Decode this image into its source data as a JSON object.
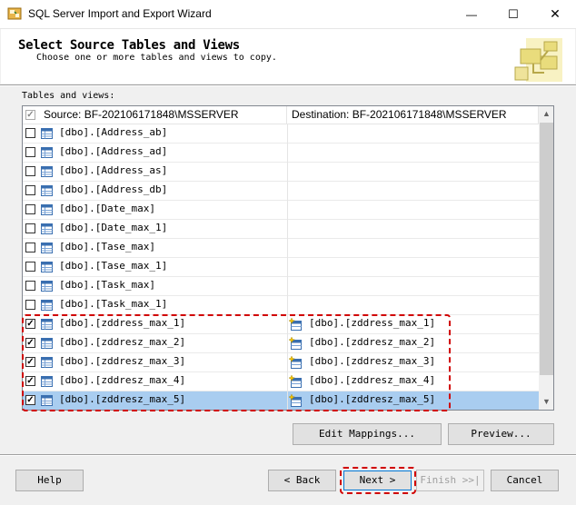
{
  "window": {
    "title": "SQL Server Import and Export Wizard",
    "minimize_glyph": "—",
    "maximize_glyph": "☐",
    "close_glyph": "✕"
  },
  "header": {
    "title": "Select Source Tables and Views",
    "subtitle": "Choose one or more tables and views to copy."
  },
  "tables_label": "Tables and views:",
  "grid": {
    "source_header": "Source: BF-202106171848\\MSSERVER",
    "destination_header": "Destination: BF-202106171848\\MSSERVER",
    "header_checked": true,
    "rows": [
      {
        "source": "[dbo].[Address_ab]",
        "destination": "",
        "checked": false,
        "selected": false
      },
      {
        "source": "[dbo].[Address_ad]",
        "destination": "",
        "checked": false,
        "selected": false
      },
      {
        "source": "[dbo].[Address_as]",
        "destination": "",
        "checked": false,
        "selected": false
      },
      {
        "source": "[dbo].[Address_db]",
        "destination": "",
        "checked": false,
        "selected": false
      },
      {
        "source": "[dbo].[Date_max]",
        "destination": "",
        "checked": false,
        "selected": false
      },
      {
        "source": "[dbo].[Date_max_1]",
        "destination": "",
        "checked": false,
        "selected": false
      },
      {
        "source": "[dbo].[Tase_max]",
        "destination": "",
        "checked": false,
        "selected": false
      },
      {
        "source": "[dbo].[Tase_max_1]",
        "destination": "",
        "checked": false,
        "selected": false
      },
      {
        "source": "[dbo].[Task_max]",
        "destination": "",
        "checked": false,
        "selected": false
      },
      {
        "source": "[dbo].[Task_max_1]",
        "destination": "",
        "checked": false,
        "selected": false
      },
      {
        "source": "[dbo].[zddress_max_1]",
        "destination": "[dbo].[zddress_max_1]",
        "checked": true,
        "selected": false
      },
      {
        "source": "[dbo].[zddresz_max_2]",
        "destination": "[dbo].[zddresz_max_2]",
        "checked": true,
        "selected": false
      },
      {
        "source": "[dbo].[zddresz_max_3]",
        "destination": "[dbo].[zddresz_max_3]",
        "checked": true,
        "selected": false
      },
      {
        "source": "[dbo].[zddresz_max_4]",
        "destination": "[dbo].[zddresz_max_4]",
        "checked": true,
        "selected": false
      },
      {
        "source": "[dbo].[zddresz_max_5]",
        "destination": "[dbo].[zddresz_max_5]",
        "checked": true,
        "selected": true
      }
    ]
  },
  "buttons": {
    "edit_mappings": "Edit Mappings...",
    "preview": "Preview...",
    "help": "Help",
    "back": "< Back",
    "next": "Next >",
    "finish": "Finish >>|",
    "cancel": "Cancel"
  },
  "colors": {
    "highlight_dash": "#d00000",
    "selected_row": "#a9cdf0"
  }
}
